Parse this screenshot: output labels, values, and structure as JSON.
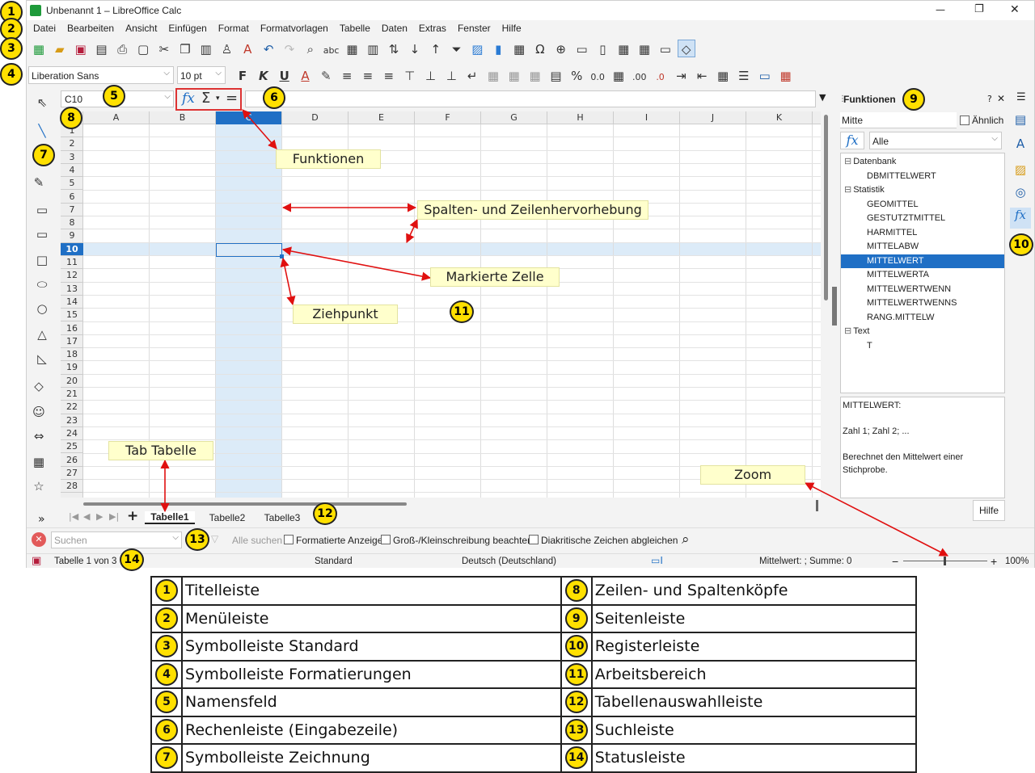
{
  "window": {
    "title": "Unbenannt 1 – LibreOffice Calc",
    "minimize": "—",
    "restore": "❐",
    "close": "✕"
  },
  "menu": [
    "Datei",
    "Bearbeiten",
    "Ansicht",
    "Einfügen",
    "Format",
    "Formatvorlagen",
    "Tabelle",
    "Daten",
    "Extras",
    "Fenster",
    "Hilfe"
  ],
  "format_bar": {
    "font_name": "Liberation Sans",
    "font_size": "10 pt"
  },
  "formula_bar": {
    "name_box": "C10",
    "fx": "fx",
    "sigma": "Σ",
    "equals": "="
  },
  "columns": [
    "A",
    "B",
    "C",
    "D",
    "E",
    "F",
    "G",
    "H",
    "I",
    "J",
    "K"
  ],
  "rows": [
    "1",
    "2",
    "3",
    "4",
    "5",
    "6",
    "7",
    "8",
    "9",
    "10",
    "11",
    "12",
    "13",
    "14",
    "15",
    "16",
    "17",
    "18",
    "19",
    "20",
    "21",
    "22",
    "23",
    "24",
    "25",
    "26",
    "27",
    "28"
  ],
  "sheet_tabs": {
    "add": "+",
    "tabs": [
      "Tabelle1",
      "Tabelle2",
      "Tabelle3"
    ],
    "more": "»"
  },
  "find_bar": {
    "placeholder": "Suchen",
    "find_all": "Alle suchen",
    "formatted": "Formatierte Anzeige",
    "match_case": "Groß-/Kleinschreibung beachten",
    "diacritics": "Diakritische Zeichen abgleichen"
  },
  "status_bar": {
    "sheet": "Tabelle 1 von 3",
    "style": "Standard",
    "language": "Deutsch (Deutschland)",
    "sum": "Mittelwert: ; Summe: 0",
    "zoom": "100%",
    "minus": "−",
    "plus": "+"
  },
  "sidebar": {
    "title": "Funktionen",
    "help_q": "?",
    "search": "Mitte",
    "similar": "Ähnlich",
    "category": "Alle",
    "tree": [
      {
        "label": "Datenbank",
        "type": "group"
      },
      {
        "label": "DBMITTELWERT",
        "type": "item"
      },
      {
        "label": "Statistik",
        "type": "group"
      },
      {
        "label": "GEOMITTEL",
        "type": "item"
      },
      {
        "label": "GESTUTZTMITTEL",
        "type": "item"
      },
      {
        "label": "HARMITTEL",
        "type": "item"
      },
      {
        "label": "MITTELABW",
        "type": "item"
      },
      {
        "label": "MITTELWERT",
        "type": "selected"
      },
      {
        "label": "MITTELWERTA",
        "type": "item"
      },
      {
        "label": "MITTELWERTWENN",
        "type": "item"
      },
      {
        "label": "MITTELWERTWENNS",
        "type": "item"
      },
      {
        "label": "RANG.MITTELW",
        "type": "item"
      },
      {
        "label": "Text",
        "type": "group"
      },
      {
        "label": "T",
        "type": "item"
      }
    ],
    "desc_name": "MITTELWERT:",
    "desc_args": "Zahl 1; Zahl 2; ...",
    "desc_text": "Berechnet den Mittelwert einer Stichprobe.",
    "help_button": "Hilfe"
  },
  "callouts": {
    "funktionen": "Funktionen",
    "spalten": "Spalten- und Zeilenhervorhebung",
    "markierte": "Markierte Zelle",
    "ziehpunkt": "Ziehpunkt",
    "tab": "Tab Tabelle",
    "zoom": "Zoom"
  },
  "badges": [
    "1",
    "2",
    "3",
    "4",
    "5",
    "6",
    "7",
    "8",
    "9",
    "10",
    "11",
    "12",
    "13",
    "14"
  ],
  "legend": [
    {
      "n": "1",
      "label": "Titelleiste",
      "n2": "8",
      "label2": "Zeilen- und Spaltenköpfe"
    },
    {
      "n": "2",
      "label": "Menüleiste",
      "n2": "9",
      "label2": "Seitenleiste"
    },
    {
      "n": "3",
      "label": "Symbolleiste Standard",
      "n2": "10",
      "label2": "Registerleiste"
    },
    {
      "n": "4",
      "label": "Symbolleiste Formatierungen",
      "n2": "11",
      "label2": "Arbeitsbereich"
    },
    {
      "n": "5",
      "label": "Namensfeld",
      "n2": "12",
      "label2": "Tabellenauswahlleiste"
    },
    {
      "n": "6",
      "label": "Rechenleiste (Eingabezeile)",
      "n2": "13",
      "label2": "Suchleiste"
    },
    {
      "n": "7",
      "label": "Symbolleiste Zeichnung",
      "n2": "14",
      "label2": "Statusleiste"
    }
  ],
  "colors": {
    "accent": "#0b6fd6",
    "highlight": "#dcebf8",
    "badge": "#ffe000",
    "callout": "#ffffcc",
    "arrow": "#e01010"
  }
}
